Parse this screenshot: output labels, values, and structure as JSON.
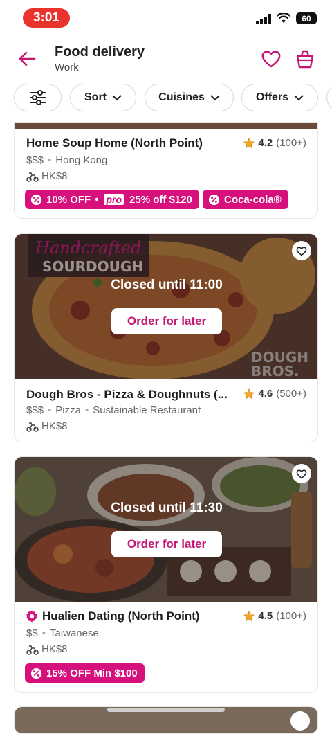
{
  "status_bar": {
    "time": "3:01",
    "battery": "60"
  },
  "header": {
    "title": "Food delivery",
    "subtitle": "Work"
  },
  "filters": {
    "sort": "Sort",
    "cuisines": "Cuisines",
    "offers": "Offers"
  },
  "colors": {
    "brand": "#d6117e",
    "time_pill": "#e8332f",
    "star": "#f5a623"
  },
  "restaurants": [
    {
      "name": "Home Soup Home (North Point)",
      "rating": "4.2",
      "reviews": "(100+)",
      "price": "$$$",
      "tags": [
        "Hong Kong"
      ],
      "fee": "HK$8",
      "promo_main": "10% OFF",
      "promo_pro_label": "pro",
      "promo_pro": "25% off $120",
      "promo_2": "Coca-cola®"
    },
    {
      "name": "Dough Bros - Pizza & Doughnuts (...",
      "rating": "4.6",
      "reviews": "(500+)",
      "price": "$$$",
      "tags": [
        "Pizza",
        "Sustainable Restaurant"
      ],
      "fee": "HK$8",
      "closed": "Closed until 11:00",
      "order_label": "Order for later",
      "image_text_1": "Handcrafted",
      "image_text_2": "SOURDOUGH",
      "image_text_3": "DOUGH",
      "image_text_4": "BROS."
    },
    {
      "name": "Hualien Dating (North Point)",
      "rating": "4.5",
      "reviews": "(100+)",
      "price": "$$",
      "tags": [
        "Taiwanese"
      ],
      "fee": "HK$8",
      "closed": "Closed until 11:30",
      "order_label": "Order for later",
      "promo_main": "15% OFF Min $100"
    }
  ]
}
